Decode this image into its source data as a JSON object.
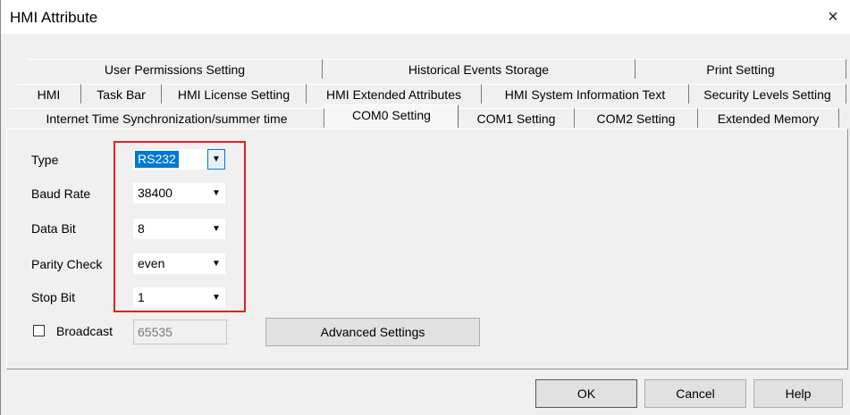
{
  "window": {
    "title": "HMI Attribute",
    "close_glyph": "×"
  },
  "tabs": {
    "row1": [
      "User Permissions Setting",
      "Historical Events Storage",
      "Print Setting"
    ],
    "row2": [
      "HMI",
      "Task Bar",
      "HMI License Setting",
      "HMI Extended Attributes",
      "HMI System Information Text",
      "Security Levels Setting"
    ],
    "row3": [
      "Internet Time Synchronization/summer time",
      "COM0 Setting",
      "COM1 Setting",
      "COM2 Setting",
      "Extended Memory"
    ],
    "selected": "COM0 Setting"
  },
  "form": {
    "type_label": "Type",
    "type_value": "RS232",
    "baud_label": "Baud Rate",
    "baud_value": "38400",
    "databit_label": "Data Bit",
    "databit_value": "8",
    "parity_label": "Parity Check",
    "parity_value": "even",
    "stopbit_label": "Stop Bit",
    "stopbit_value": "1",
    "broadcast_label": "Broadcast",
    "broadcast_value": "65535",
    "advanced_label": "Advanced Settings"
  },
  "buttons": {
    "ok": "OK",
    "cancel": "Cancel",
    "help": "Help"
  },
  "colors": {
    "highlight": "#0078d7",
    "annotation_box": "#e02020"
  }
}
